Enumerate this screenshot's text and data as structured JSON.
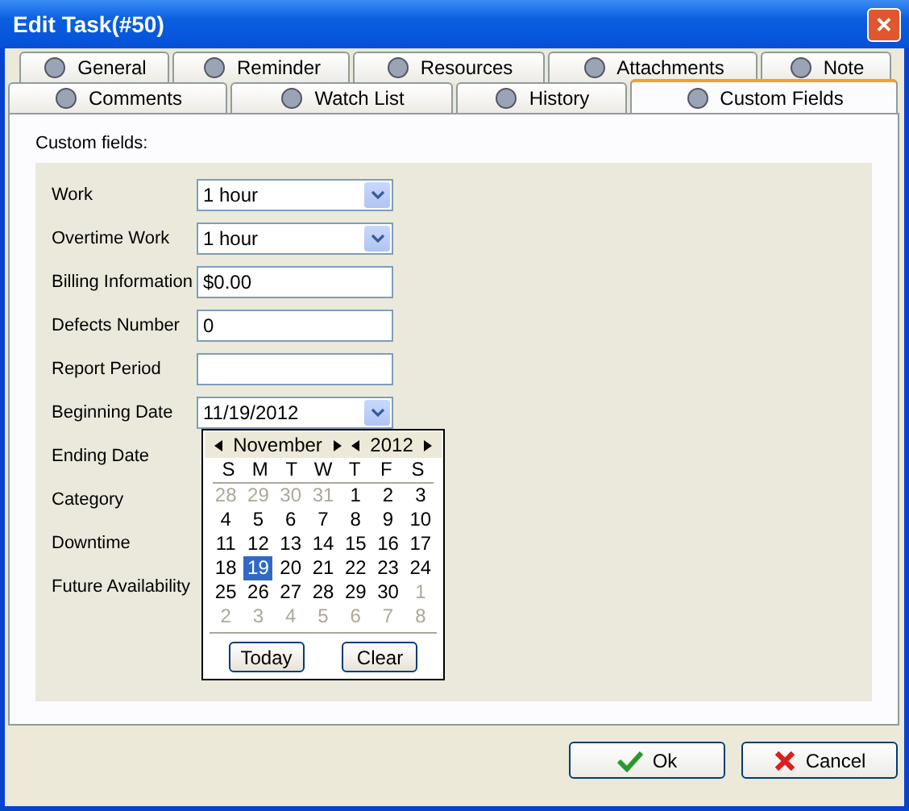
{
  "window": {
    "title": "Edit Task(#50)",
    "close": "✕"
  },
  "tab_rows": [
    [
      {
        "label": "General",
        "selected": false
      },
      {
        "label": "Reminder",
        "selected": false
      },
      {
        "label": "Resources",
        "selected": false
      },
      {
        "label": "Attachments",
        "selected": false
      },
      {
        "label": "Note",
        "selected": false
      }
    ],
    [
      {
        "label": "Comments",
        "selected": false
      },
      {
        "label": "Watch List",
        "selected": false
      },
      {
        "label": "History",
        "selected": false
      },
      {
        "label": "Custom Fields",
        "selected": true
      }
    ]
  ],
  "section_label": "Custom fields:",
  "fields": [
    {
      "label": "Work",
      "kind": "dropdown",
      "value": "1 hour"
    },
    {
      "label": "Overtime Work",
      "kind": "dropdown",
      "value": "1 hour"
    },
    {
      "label": "Billing Information",
      "kind": "text",
      "value": "$0.00"
    },
    {
      "label": "Defects Number",
      "kind": "text",
      "value": "0"
    },
    {
      "label": "Report Period",
      "kind": "text"
    },
    {
      "label": "Beginning Date",
      "kind": "dropdown",
      "value": "11/19/2012"
    },
    {
      "label": "Ending Date",
      "kind": "covered"
    },
    {
      "label": "Category",
      "kind": "covered"
    },
    {
      "label": "Downtime",
      "kind": "covered"
    },
    {
      "label": "Future Availability",
      "kind": "covered"
    }
  ],
  "calendar": {
    "month": "November",
    "year": "2012",
    "weekdays": [
      "S",
      "M",
      "T",
      "W",
      "T",
      "F",
      "S"
    ],
    "weeks": [
      [
        {
          "day": "28",
          "muted": true,
          "selected": false
        },
        {
          "day": "29",
          "muted": true,
          "selected": false
        },
        {
          "day": "30",
          "muted": true,
          "selected": false
        },
        {
          "day": "31",
          "muted": true,
          "selected": false
        },
        {
          "day": "1",
          "muted": false,
          "selected": false
        },
        {
          "day": "2",
          "muted": false,
          "selected": false
        },
        {
          "day": "3",
          "muted": false,
          "selected": false
        }
      ],
      [
        {
          "day": "4",
          "muted": false,
          "selected": false
        },
        {
          "day": "5",
          "muted": false,
          "selected": false
        },
        {
          "day": "6",
          "muted": false,
          "selected": false
        },
        {
          "day": "7",
          "muted": false,
          "selected": false
        },
        {
          "day": "8",
          "muted": false,
          "selected": false
        },
        {
          "day": "9",
          "muted": false,
          "selected": false
        },
        {
          "day": "10",
          "muted": false,
          "selected": false
        }
      ],
      [
        {
          "day": "11",
          "muted": false,
          "selected": false
        },
        {
          "day": "12",
          "muted": false,
          "selected": false
        },
        {
          "day": "13",
          "muted": false,
          "selected": false
        },
        {
          "day": "14",
          "muted": false,
          "selected": false
        },
        {
          "day": "15",
          "muted": false,
          "selected": false
        },
        {
          "day": "16",
          "muted": false,
          "selected": false
        },
        {
          "day": "17",
          "muted": false,
          "selected": false
        }
      ],
      [
        {
          "day": "18",
          "muted": false,
          "selected": false
        },
        {
          "day": "19",
          "muted": false,
          "selected": true
        },
        {
          "day": "20",
          "muted": false,
          "selected": false
        },
        {
          "day": "21",
          "muted": false,
          "selected": false
        },
        {
          "day": "22",
          "muted": false,
          "selected": false
        },
        {
          "day": "23",
          "muted": false,
          "selected": false
        },
        {
          "day": "24",
          "muted": false,
          "selected": false
        }
      ],
      [
        {
          "day": "25",
          "muted": false,
          "selected": false
        },
        {
          "day": "26",
          "muted": false,
          "selected": false
        },
        {
          "day": "27",
          "muted": false,
          "selected": false
        },
        {
          "day": "28",
          "muted": false,
          "selected": false
        },
        {
          "day": "29",
          "muted": false,
          "selected": false
        },
        {
          "day": "30",
          "muted": false,
          "selected": false
        },
        {
          "day": "1",
          "muted": true,
          "selected": false
        }
      ],
      [
        {
          "day": "2",
          "muted": true,
          "selected": false
        },
        {
          "day": "3",
          "muted": true,
          "selected": false
        },
        {
          "day": "4",
          "muted": true,
          "selected": false
        },
        {
          "day": "5",
          "muted": true,
          "selected": false
        },
        {
          "day": "6",
          "muted": true,
          "selected": false
        },
        {
          "day": "7",
          "muted": true,
          "selected": false
        },
        {
          "day": "8",
          "muted": true,
          "selected": false
        }
      ]
    ],
    "buttons": [
      "Today",
      "Clear"
    ]
  },
  "footer": {
    "ok": "Ok",
    "cancel": "Cancel"
  }
}
